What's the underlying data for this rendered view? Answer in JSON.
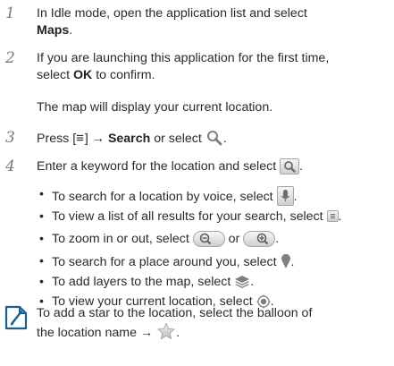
{
  "steps": [
    {
      "num": "1",
      "pre": "In Idle mode, open the application list and select",
      "bold": "Maps",
      "post": "."
    },
    {
      "num": "2",
      "line1": "If you are launching this application for the first time,",
      "pre2": "select ",
      "bold": "OK",
      "post": " to confirm.",
      "sub": "The map will display your current location."
    },
    {
      "num": "3",
      "pre": "Press [",
      "menu_glyph": "≡",
      "mid": "] → ",
      "bold": "Search",
      "post": " or select",
      "end": "."
    },
    {
      "num": "4",
      "pre": "Enter a keyword for the location and select",
      "end": "."
    }
  ],
  "bullets": [
    {
      "dot": "•",
      "text": "To search for a location by voice, select",
      "end": "."
    },
    {
      "dot": "•",
      "text": "To view a list of all results for your search, select",
      "end": "."
    },
    {
      "dot": "•",
      "text": "To zoom in or out, select",
      "mid": " or ",
      "end": "."
    },
    {
      "dot": "•",
      "text": "To search for a place around you, select",
      "end": "."
    },
    {
      "dot": "•",
      "text": "To add layers to the map, select",
      "end": "."
    },
    {
      "dot": "•",
      "text": "To view your current location, select",
      "end": "."
    }
  ],
  "note": {
    "line1": "To add a star to the location, select the balloon of",
    "line2": "the location name →",
    "end": "."
  },
  "icons": {
    "search": "search-icon",
    "search_button": "search-button-icon",
    "mic": "microphone-icon",
    "list": "list-icon",
    "zoom_out": "zoom-out-icon",
    "zoom_in": "zoom-in-icon",
    "place": "place-pin-icon",
    "layers": "layers-icon",
    "location": "my-location-icon",
    "star": "star-icon",
    "note": "note-pencil-icon"
  },
  "colors": {
    "text": "#2a2a2a",
    "step_number": "#7a7a7a",
    "icon_gray": "#7f7f7f",
    "note_icon": "#1b5f8f"
  }
}
